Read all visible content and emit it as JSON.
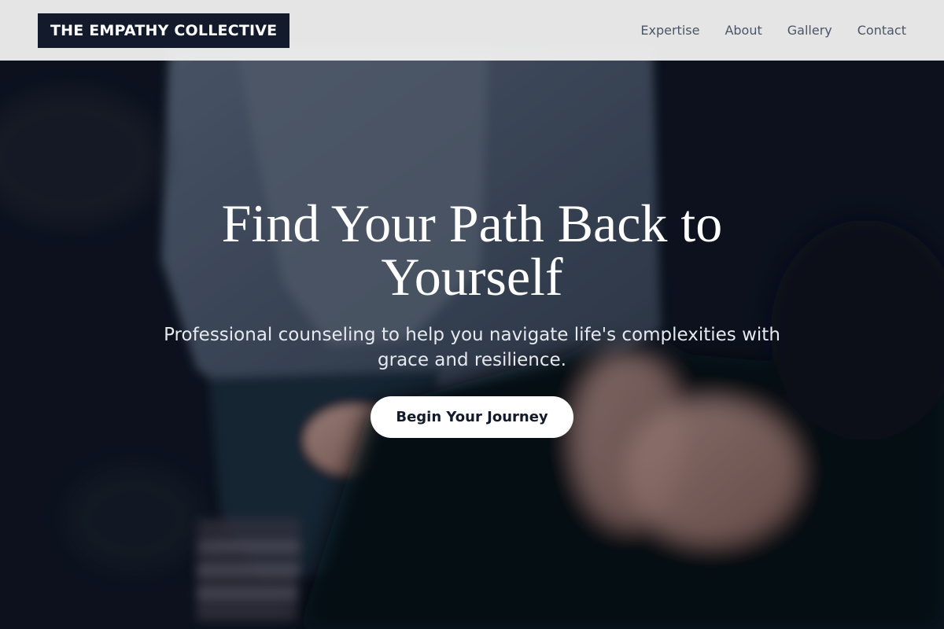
{
  "brand": {
    "name": "THE EMPATHY COLLECTIVE"
  },
  "nav": {
    "links": [
      "Expertise",
      "About",
      "Gallery",
      "Contact"
    ]
  },
  "hero": {
    "title": "Find Your Path Back to Yourself",
    "subtitle": "Professional counseling to help you navigate life's complexities with grace and resilience.",
    "cta_label": "Begin Your Journey"
  },
  "colors": {
    "brand_bg": "#121a2b",
    "nav_bg": "#eeeeee",
    "nav_text": "#4a5568",
    "cta_bg": "#ffffff",
    "hero_overlay": "#0a101c"
  }
}
